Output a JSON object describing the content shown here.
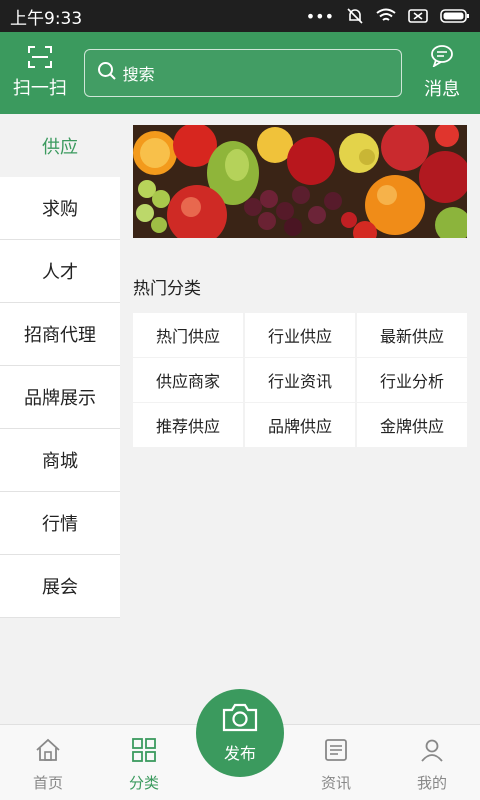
{
  "status_bar": {
    "time": "上午9:33"
  },
  "header": {
    "scan_label": "扫一扫",
    "search_placeholder": "搜索",
    "message_label": "消息"
  },
  "sidebar": {
    "items": [
      {
        "label": "供应",
        "active": true
      },
      {
        "label": "求购"
      },
      {
        "label": "人才"
      },
      {
        "label": "招商代理"
      },
      {
        "label": "品牌展示"
      },
      {
        "label": "商城"
      },
      {
        "label": "行情"
      },
      {
        "label": "展会"
      }
    ]
  },
  "main": {
    "banner_icon": "fruit-banner-image",
    "section_title": "热门分类",
    "categories": [
      "热门供应",
      "行业供应",
      "最新供应",
      "供应商家",
      "行业资讯",
      "行业分析",
      "推荐供应",
      "品牌供应",
      "金牌供应"
    ]
  },
  "bottom_nav": {
    "items": [
      {
        "label": "首页",
        "icon": "home-icon"
      },
      {
        "label": "分类",
        "icon": "grid-icon",
        "active": true
      },
      {
        "label": "发布",
        "icon": "camera-icon"
      },
      {
        "label": "资讯",
        "icon": "news-icon"
      },
      {
        "label": "我的",
        "icon": "user-icon"
      }
    ]
  },
  "colors": {
    "accent": "#3b9a5e",
    "status_bar": "#1f1f1f",
    "background": "#f2f2f2"
  }
}
